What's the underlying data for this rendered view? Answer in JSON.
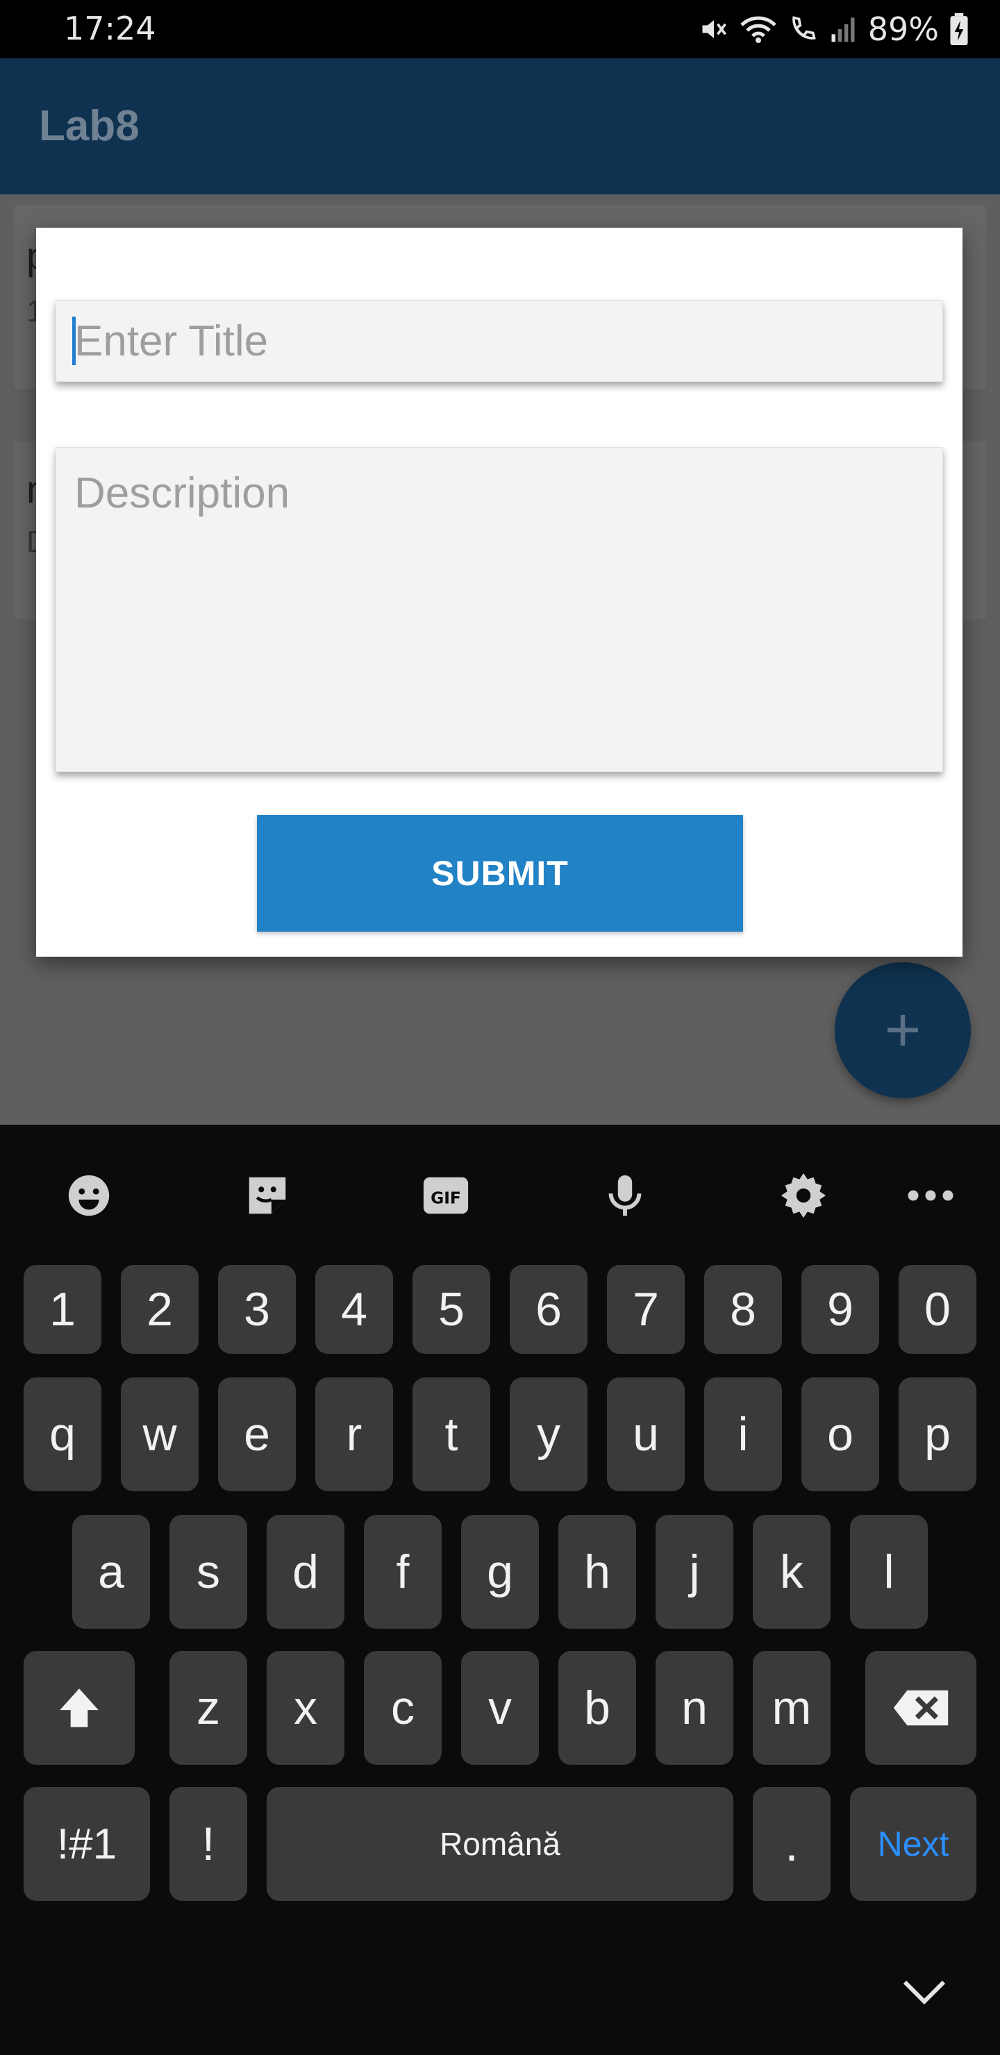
{
  "status_bar": {
    "time": "17:24",
    "battery": "89%"
  },
  "app": {
    "title": "Lab8",
    "list_peek": [
      {
        "line1": "p",
        "line2": "1"
      },
      {
        "line1": "n",
        "line2": "D"
      }
    ],
    "fab_label": "+"
  },
  "dialog": {
    "title_placeholder": "Enter Title",
    "description_placeholder": "Description",
    "submit_label": "SUBMIT"
  },
  "keyboard": {
    "toolbar": [
      "emoji-icon",
      "sticker-icon",
      "gif-icon",
      "microphone-icon",
      "settings-icon",
      "more-icon"
    ],
    "gif_label": "GIF",
    "rows": [
      [
        "1",
        "2",
        "3",
        "4",
        "5",
        "6",
        "7",
        "8",
        "9",
        "0"
      ],
      [
        "q",
        "w",
        "e",
        "r",
        "t",
        "y",
        "u",
        "i",
        "o",
        "p"
      ],
      [
        "a",
        "s",
        "d",
        "f",
        "g",
        "h",
        "j",
        "k",
        "l"
      ],
      [
        "z",
        "x",
        "c",
        "v",
        "b",
        "n",
        "m"
      ]
    ],
    "symbols_label": "!#1",
    "exclaim_label": "!",
    "space_label": "Română",
    "period_label": ".",
    "next_label": "Next"
  },
  "colors": {
    "app_bar": "#0f3250",
    "submit": "#2282c6",
    "next_key_text": "#2b8fff",
    "caret": "#1f7fd0"
  }
}
